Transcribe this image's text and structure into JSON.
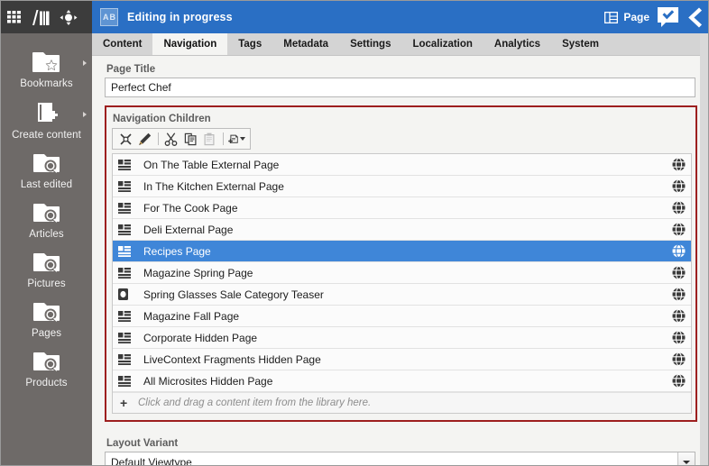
{
  "rail": {
    "top_icons": [
      {
        "name": "apps-grid-icon",
        "label": "Apps"
      },
      {
        "name": "library-icon",
        "label": "Library"
      },
      {
        "name": "navigation-move-icon",
        "label": "Navigate"
      }
    ],
    "items": [
      {
        "label": "Bookmarks",
        "icon": "folder-star-icon",
        "has_submenu": true
      },
      {
        "label": "Create content",
        "icon": "create-content-icon",
        "has_submenu": true
      },
      {
        "label": "Last edited",
        "icon": "folder-search-icon",
        "has_submenu": false
      },
      {
        "label": "Articles",
        "icon": "folder-search-icon",
        "has_submenu": false
      },
      {
        "label": "Pictures",
        "icon": "folder-search-icon",
        "has_submenu": false
      },
      {
        "label": "Pages",
        "icon": "folder-search-icon",
        "has_submenu": false
      },
      {
        "label": "Products",
        "icon": "folder-search-icon",
        "has_submenu": false
      }
    ]
  },
  "header": {
    "badge_letters": [
      "A",
      "B"
    ],
    "title": "Editing in progress",
    "page_button_label": "Page",
    "page_icon": "page-layout-icon",
    "approve_icon": "approval-check-icon",
    "collapse_icon": "chevron-left-icon"
  },
  "tabs": [
    {
      "label": "Content",
      "active": false
    },
    {
      "label": "Navigation",
      "active": true
    },
    {
      "label": "Tags",
      "active": false
    },
    {
      "label": "Metadata",
      "active": false
    },
    {
      "label": "Settings",
      "active": false
    },
    {
      "label": "Localization",
      "active": false
    },
    {
      "label": "Analytics",
      "active": false
    },
    {
      "label": "System",
      "active": false
    }
  ],
  "page_title": {
    "label": "Page Title",
    "value": "Perfect Chef"
  },
  "navigation_children": {
    "label": "Navigation Children",
    "highlight_color": "#9d1f1f",
    "toolbar": [
      {
        "name": "remove-link-button",
        "title": "Remove link",
        "disabled": false
      },
      {
        "name": "edit-button",
        "title": "Edit",
        "disabled": false
      },
      {
        "name": "cut-button",
        "title": "Cut",
        "disabled": false
      },
      {
        "name": "copy-button",
        "title": "Copy",
        "disabled": false
      },
      {
        "name": "paste-button",
        "title": "Paste",
        "disabled": true
      },
      {
        "name": "new-content-button",
        "title": "New content",
        "disabled": false
      }
    ],
    "rows": [
      {
        "label": "On The Table External Page",
        "type_icon": "page-list-icon",
        "site_icon": "site-globe-icon",
        "selected": false
      },
      {
        "label": "In The Kitchen External Page",
        "type_icon": "page-list-icon",
        "site_icon": "site-globe-icon",
        "selected": false
      },
      {
        "label": "For The Cook Page",
        "type_icon": "page-list-icon",
        "site_icon": "site-globe-icon",
        "selected": false
      },
      {
        "label": "Deli External Page",
        "type_icon": "page-list-icon",
        "site_icon": "site-globe-icon",
        "selected": false
      },
      {
        "label": "Recipes Page",
        "type_icon": "page-list-icon",
        "site_icon": "site-globe-icon",
        "selected": true
      },
      {
        "label": "Magazine Spring Page",
        "type_icon": "page-list-icon",
        "site_icon": "site-globe-icon",
        "selected": false
      },
      {
        "label": "Spring Glasses Sale Category Teaser",
        "type_icon": "teaser-icon",
        "site_icon": "site-globe-icon",
        "selected": false
      },
      {
        "label": "Magazine Fall Page",
        "type_icon": "page-list-icon",
        "site_icon": "site-globe-icon",
        "selected": false
      },
      {
        "label": "Corporate Hidden Page",
        "type_icon": "page-list-icon",
        "site_icon": "site-globe-icon",
        "selected": false
      },
      {
        "label": "LiveContext Fragments Hidden Page",
        "type_icon": "page-list-icon",
        "site_icon": "site-globe-icon",
        "selected": false
      },
      {
        "label": "All Microsites Hidden Page",
        "type_icon": "page-list-icon",
        "site_icon": "site-globe-icon",
        "selected": false
      }
    ],
    "drop_hint": "Click and drag a content item from the library here.",
    "drop_plus": "+"
  },
  "layout_variant": {
    "label": "Layout Variant",
    "value": "Default Viewtype"
  }
}
